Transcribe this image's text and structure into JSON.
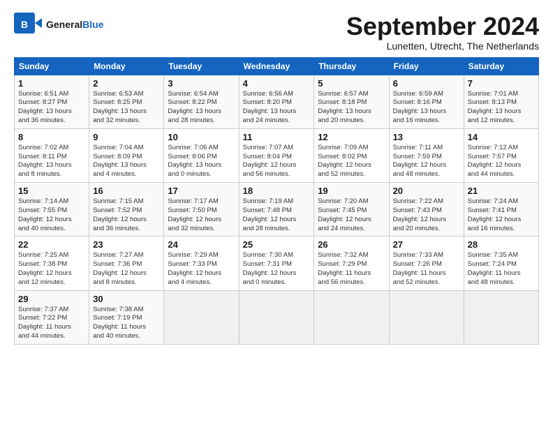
{
  "header": {
    "logo_general": "General",
    "logo_blue": "Blue",
    "month_title": "September 2024",
    "subtitle": "Lunetten, Utrecht, The Netherlands"
  },
  "weekdays": [
    "Sunday",
    "Monday",
    "Tuesday",
    "Wednesday",
    "Thursday",
    "Friday",
    "Saturday"
  ],
  "weeks": [
    [
      {
        "day": "1",
        "info": "Sunrise: 6:51 AM\nSunset: 8:27 PM\nDaylight: 13 hours\nand 36 minutes."
      },
      {
        "day": "2",
        "info": "Sunrise: 6:53 AM\nSunset: 8:25 PM\nDaylight: 13 hours\nand 32 minutes."
      },
      {
        "day": "3",
        "info": "Sunrise: 6:54 AM\nSunset: 8:22 PM\nDaylight: 13 hours\nand 28 minutes."
      },
      {
        "day": "4",
        "info": "Sunrise: 6:56 AM\nSunset: 8:20 PM\nDaylight: 13 hours\nand 24 minutes."
      },
      {
        "day": "5",
        "info": "Sunrise: 6:57 AM\nSunset: 8:18 PM\nDaylight: 13 hours\nand 20 minutes."
      },
      {
        "day": "6",
        "info": "Sunrise: 6:59 AM\nSunset: 8:16 PM\nDaylight: 13 hours\nand 16 minutes."
      },
      {
        "day": "7",
        "info": "Sunrise: 7:01 AM\nSunset: 8:13 PM\nDaylight: 13 hours\nand 12 minutes."
      }
    ],
    [
      {
        "day": "8",
        "info": "Sunrise: 7:02 AM\nSunset: 8:11 PM\nDaylight: 13 hours\nand 8 minutes."
      },
      {
        "day": "9",
        "info": "Sunrise: 7:04 AM\nSunset: 8:09 PM\nDaylight: 13 hours\nand 4 minutes."
      },
      {
        "day": "10",
        "info": "Sunrise: 7:06 AM\nSunset: 8:06 PM\nDaylight: 13 hours\nand 0 minutes."
      },
      {
        "day": "11",
        "info": "Sunrise: 7:07 AM\nSunset: 8:04 PM\nDaylight: 12 hours\nand 56 minutes."
      },
      {
        "day": "12",
        "info": "Sunrise: 7:09 AM\nSunset: 8:02 PM\nDaylight: 12 hours\nand 52 minutes."
      },
      {
        "day": "13",
        "info": "Sunrise: 7:11 AM\nSunset: 7:59 PM\nDaylight: 12 hours\nand 48 minutes."
      },
      {
        "day": "14",
        "info": "Sunrise: 7:12 AM\nSunset: 7:57 PM\nDaylight: 12 hours\nand 44 minutes."
      }
    ],
    [
      {
        "day": "15",
        "info": "Sunrise: 7:14 AM\nSunset: 7:55 PM\nDaylight: 12 hours\nand 40 minutes."
      },
      {
        "day": "16",
        "info": "Sunrise: 7:15 AM\nSunset: 7:52 PM\nDaylight: 12 hours\nand 36 minutes."
      },
      {
        "day": "17",
        "info": "Sunrise: 7:17 AM\nSunset: 7:50 PM\nDaylight: 12 hours\nand 32 minutes."
      },
      {
        "day": "18",
        "info": "Sunrise: 7:19 AM\nSunset: 7:48 PM\nDaylight: 12 hours\nand 28 minutes."
      },
      {
        "day": "19",
        "info": "Sunrise: 7:20 AM\nSunset: 7:45 PM\nDaylight: 12 hours\nand 24 minutes."
      },
      {
        "day": "20",
        "info": "Sunrise: 7:22 AM\nSunset: 7:43 PM\nDaylight: 12 hours\nand 20 minutes."
      },
      {
        "day": "21",
        "info": "Sunrise: 7:24 AM\nSunset: 7:41 PM\nDaylight: 12 hours\nand 16 minutes."
      }
    ],
    [
      {
        "day": "22",
        "info": "Sunrise: 7:25 AM\nSunset: 7:38 PM\nDaylight: 12 hours\nand 12 minutes."
      },
      {
        "day": "23",
        "info": "Sunrise: 7:27 AM\nSunset: 7:36 PM\nDaylight: 12 hours\nand 8 minutes."
      },
      {
        "day": "24",
        "info": "Sunrise: 7:29 AM\nSunset: 7:33 PM\nDaylight: 12 hours\nand 4 minutes."
      },
      {
        "day": "25",
        "info": "Sunrise: 7:30 AM\nSunset: 7:31 PM\nDaylight: 12 hours\nand 0 minutes."
      },
      {
        "day": "26",
        "info": "Sunrise: 7:32 AM\nSunset: 7:29 PM\nDaylight: 11 hours\nand 56 minutes."
      },
      {
        "day": "27",
        "info": "Sunrise: 7:33 AM\nSunset: 7:26 PM\nDaylight: 11 hours\nand 52 minutes."
      },
      {
        "day": "28",
        "info": "Sunrise: 7:35 AM\nSunset: 7:24 PM\nDaylight: 11 hours\nand 48 minutes."
      }
    ],
    [
      {
        "day": "29",
        "info": "Sunrise: 7:37 AM\nSunset: 7:22 PM\nDaylight: 11 hours\nand 44 minutes."
      },
      {
        "day": "30",
        "info": "Sunrise: 7:38 AM\nSunset: 7:19 PM\nDaylight: 11 hours\nand 40 minutes."
      },
      null,
      null,
      null,
      null,
      null
    ]
  ]
}
